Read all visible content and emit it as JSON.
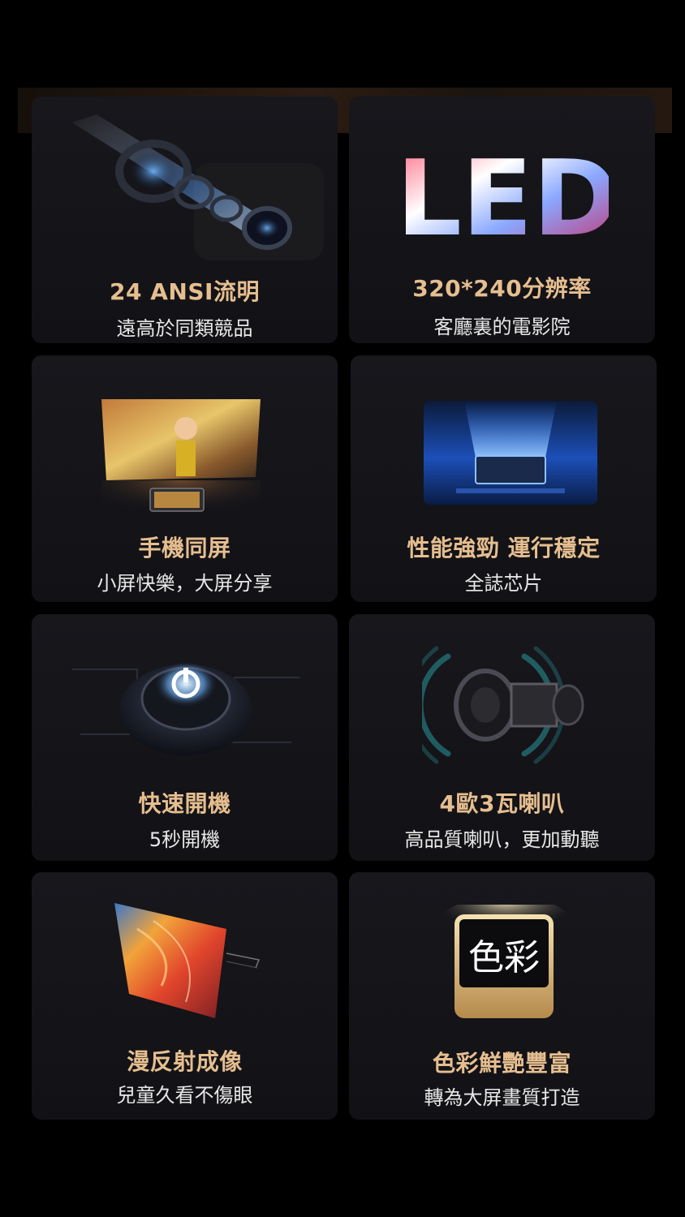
{
  "features": [
    {
      "title": "24 ANSI流明",
      "subtitle": "遠高於同類競品",
      "icon": "lens-icon"
    },
    {
      "title": "320*240分辨率",
      "subtitle": "客廳裏的電影院",
      "icon": "led-logo",
      "logo_text": "LED"
    },
    {
      "title": "手機同屏",
      "subtitle": "小屏快樂，大屏分享",
      "icon": "screen-mirroring-icon"
    },
    {
      "title": "性能強勁 運行穩定",
      "subtitle": "全誌芯片",
      "icon": "chip-icon"
    },
    {
      "title": "快速開機",
      "subtitle": "5秒開機",
      "icon": "power-icon"
    },
    {
      "title": "4歐3瓦喇叭",
      "subtitle": "高品質喇叭，更加動聽",
      "icon": "speaker-icon"
    },
    {
      "title": "漫反射成像",
      "subtitle": "兒童久看不傷眼",
      "icon": "diffuse-screen-icon"
    },
    {
      "title": "色彩鮮艷豐富",
      "subtitle": "轉為大屏畫質打造",
      "icon": "color-badge-icon",
      "badge_text": "色彩"
    }
  ],
  "colors": {
    "title": "#e6be8f",
    "subtitle": "#e8e8e8",
    "card": "#151519",
    "background": "#000000"
  }
}
